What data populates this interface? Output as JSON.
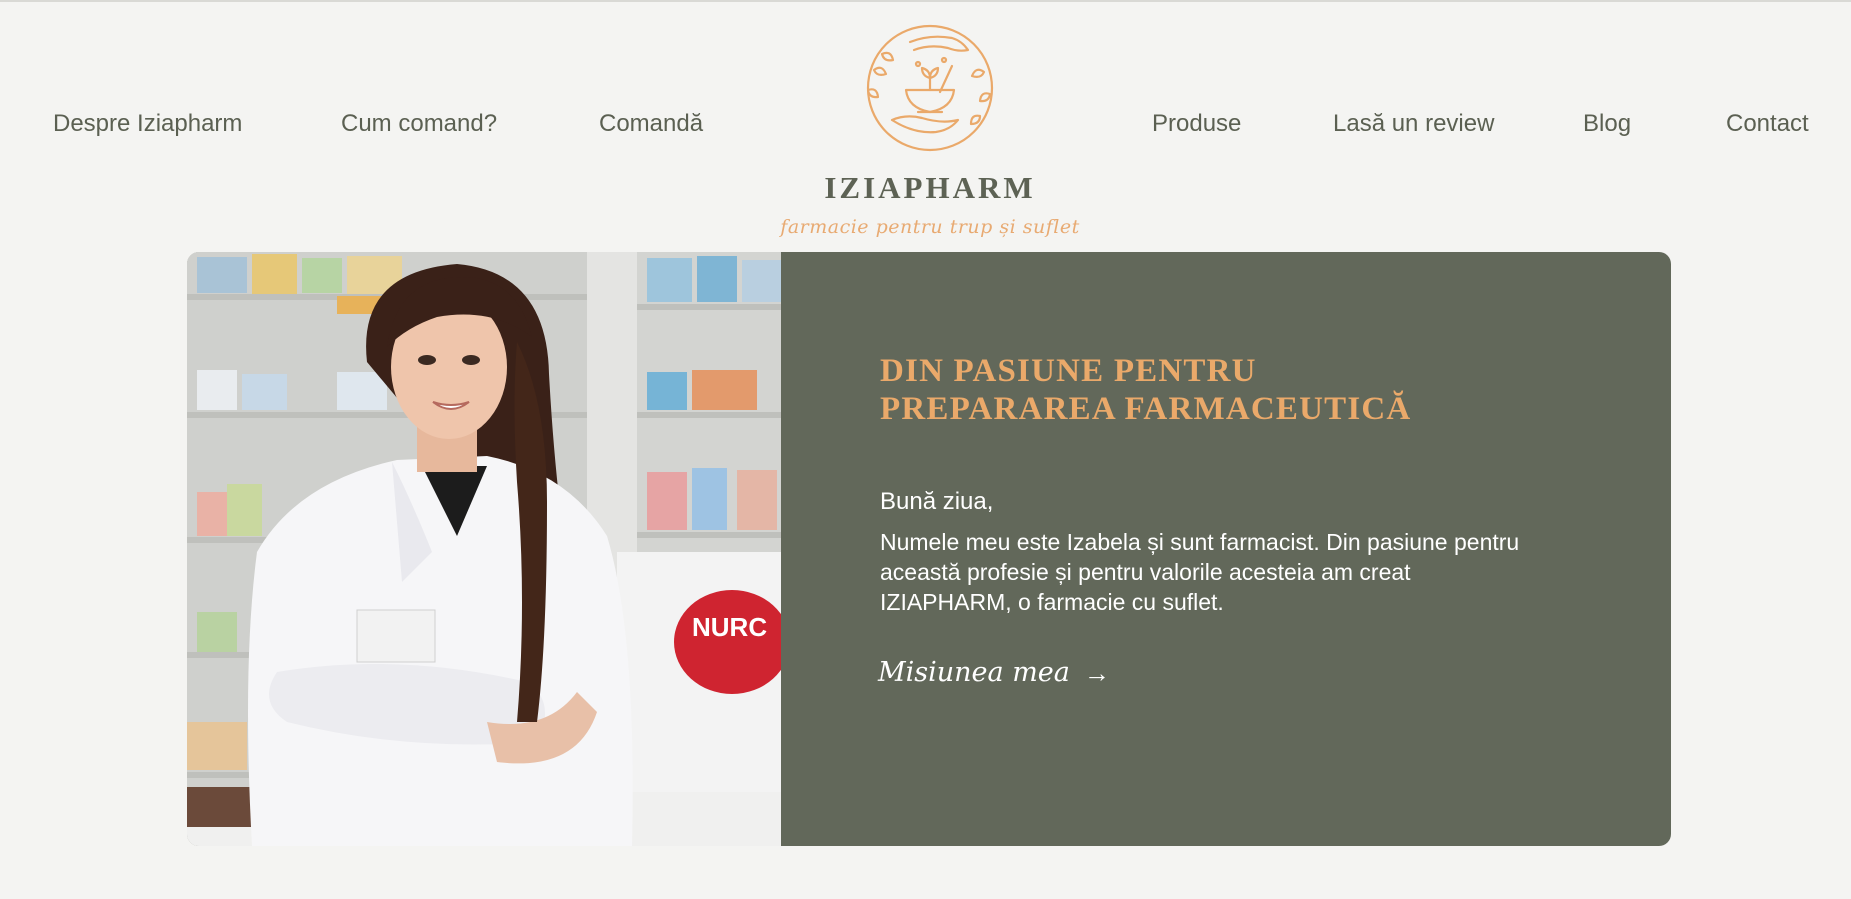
{
  "nav": {
    "left": [
      {
        "label": "Despre Iziapharm"
      },
      {
        "label": "Cum comand?"
      },
      {
        "label": "Comandă"
      }
    ],
    "right": [
      {
        "label": "Produse"
      },
      {
        "label": "Lasă un review"
      },
      {
        "label": "Blog"
      },
      {
        "label": "Contact"
      }
    ]
  },
  "logo": {
    "name": "IZIAPHARM",
    "tagline": "farmacie pentru trup și suflet",
    "emblem_icon": "mortar-pestle-hands-wreath-icon"
  },
  "hero": {
    "title_line1": "Din pasiune pentru",
    "title_line2": "prepararea farmaceutică",
    "greeting": "Bună ziua,",
    "body": "Numele meu este Izabela și sunt farmacist. Din pasiune pentru această profesie și pentru valorile acesteia am creat IZIAPHARM, o farmacie cu suflet.",
    "cta_label": "Misiunea mea",
    "cta_icon": "arrow-right-icon",
    "photo_label": "NURC"
  },
  "colors": {
    "background": "#f4f4f2",
    "nav_text": "#5b6052",
    "accent_orange": "#eaa96a",
    "hero_panel": "#62685a"
  }
}
